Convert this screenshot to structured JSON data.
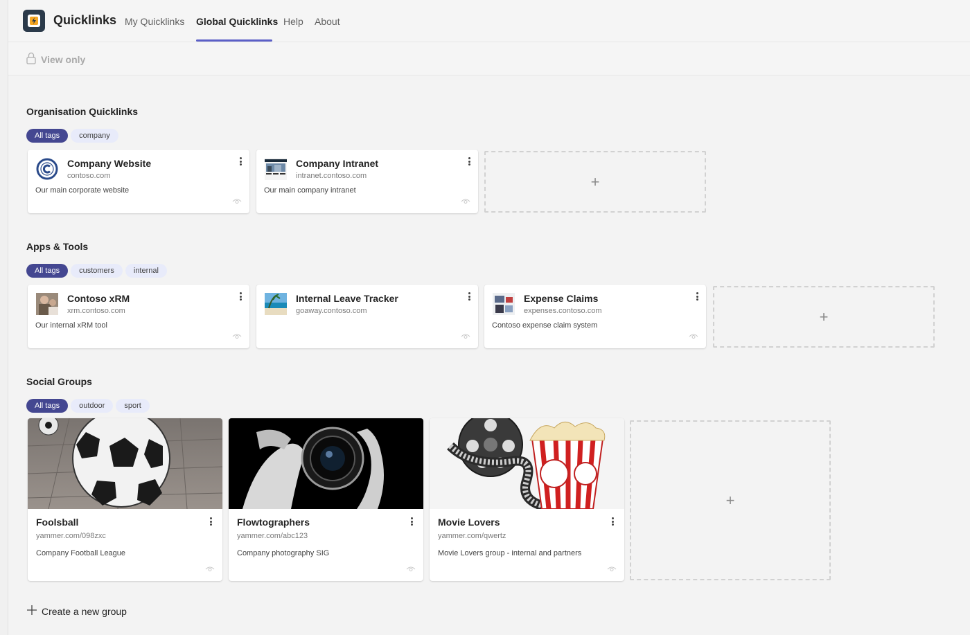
{
  "app": {
    "title": "Quicklinks",
    "nav": [
      "My Quicklinks",
      "Global Quicklinks",
      "Help",
      "About"
    ],
    "active_nav": "Global Quicklinks",
    "accent_color": "#5b5fc7"
  },
  "command_bar": {
    "view_only_label": "View only",
    "icon": "lock-icon"
  },
  "sections": [
    {
      "title": "Organisation Quicklinks",
      "tags": [
        "All tags",
        "company"
      ],
      "cards": [
        {
          "title": "Company Website",
          "url": "contoso.com",
          "description": "Our main corporate website",
          "icon": "copyright-logo-icon"
        },
        {
          "title": "Company Intranet",
          "url": "intranet.contoso.com",
          "description": "Our main company intranet",
          "icon": "intranet-thumbnail"
        }
      ]
    },
    {
      "title": "Apps & Tools",
      "tags": [
        "All tags",
        "customers",
        "internal"
      ],
      "cards": [
        {
          "title": "Contoso xRM",
          "url": "xrm.contoso.com",
          "description": "Our internal xRM tool",
          "icon": "xrm-thumbnail"
        },
        {
          "title": "Internal Leave Tracker",
          "url": "goaway.contoso.com",
          "description": "",
          "icon": "beach-thumbnail"
        },
        {
          "title": "Expense Claims",
          "url": "expenses.contoso.com",
          "description": "Contoso expense claim system",
          "icon": "expenses-thumbnail"
        }
      ]
    },
    {
      "title": "Social Groups",
      "tags": [
        "All tags",
        "outdoor",
        "sport"
      ],
      "groups": [
        {
          "title": "Foolsball",
          "url": "yammer.com/098zxc",
          "description": "Company Football League",
          "image": "soccer-ball-image"
        },
        {
          "title": "Flowtographers",
          "url": "yammer.com/abc123",
          "description": "Company photography SIG",
          "image": "camera-lens-image"
        },
        {
          "title": "Movie Lovers",
          "url": "yammer.com/qwertz",
          "description": "Movie Lovers group - internal and partners",
          "image": "film-reel-popcorn-image"
        }
      ]
    }
  ],
  "add_symbol": "+",
  "create_group_label": "Create a new group"
}
